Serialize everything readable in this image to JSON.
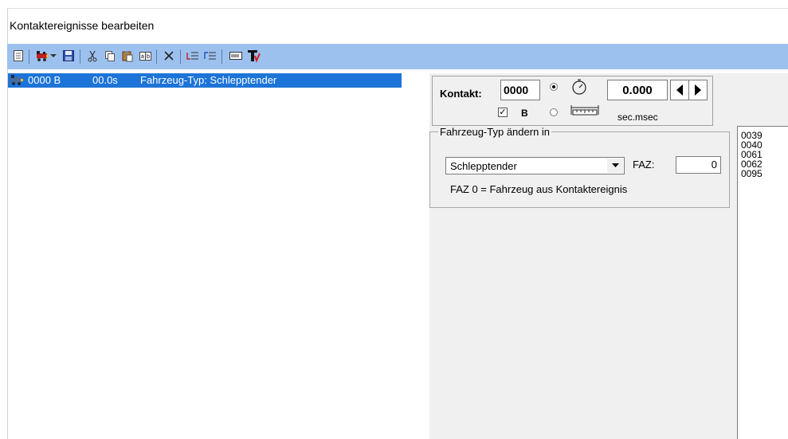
{
  "window": {
    "title": "Kontaktereignisse bearbeiten"
  },
  "toolbar": {
    "icons": [
      "new-document-icon",
      "locomotive-icon",
      "dropdown-arrow-icon",
      "save-icon",
      "cut-icon",
      "copy-icon",
      "paste-icon",
      "replace-icon",
      "delete-icon",
      "insert-before-icon",
      "insert-after-icon",
      "display-icon",
      "text-tool-icon"
    ],
    "accent": "#9dc1ef"
  },
  "event_list": {
    "selected_color": "#1d74d8",
    "rows": [
      {
        "number": "0000 B",
        "time": "00.0s",
        "description": "Fahrzeug-Typ: Schlepptender"
      }
    ]
  },
  "contact_panel": {
    "kontakt_label": "Kontakt:",
    "kontakt_value": "0000",
    "time_value": "0.000",
    "checkbox_label": "B",
    "checkbox_checked": true,
    "unit_label": "sec.msec",
    "radio_selected": "time"
  },
  "type_group": {
    "legend": "Fahrzeug-Typ ändern in",
    "selected_type": "Schlepptender",
    "faz_label": "FAZ:",
    "faz_value": "0",
    "note": "FAZ 0 = Fahrzeug aus Kontaktereignis"
  },
  "contact_list": {
    "items": [
      "0039",
      "0040",
      "0061",
      "0062",
      "0095"
    ]
  }
}
